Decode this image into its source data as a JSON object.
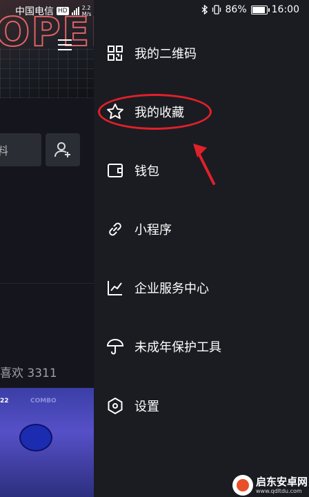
{
  "status_bar": {
    "carrier": "中国电信",
    "hd": "HD",
    "speed_top": "2.2",
    "speed_unit": "M/s",
    "battery": "86%",
    "time": "16:00"
  },
  "background_page": {
    "edit_partial": "料",
    "likes_text": "喜欢 3311",
    "thumb_num": "22",
    "thumb_combo": "COMBO"
  },
  "drawer": {
    "items": [
      {
        "label": "我的二维码",
        "icon": "qr-code-icon"
      },
      {
        "label": "我的收藏",
        "icon": "star-icon"
      },
      {
        "label": "钱包",
        "icon": "wallet-icon"
      },
      {
        "label": "小程序",
        "icon": "link-icon"
      },
      {
        "label": "企业服务中心",
        "icon": "chart-icon"
      },
      {
        "label": "未成年保护工具",
        "icon": "umbrella-icon"
      },
      {
        "label": "设置",
        "icon": "settings-hexagon-icon"
      }
    ]
  },
  "annotation_color": "#e2202a",
  "watermark": {
    "name": "启东安卓网",
    "url": "www.qdltdu.com"
  }
}
